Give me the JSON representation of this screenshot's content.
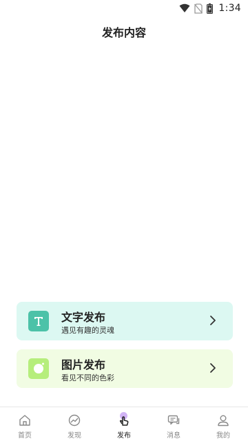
{
  "status_bar": {
    "time": "1:34"
  },
  "page": {
    "title": "发布内容"
  },
  "cards": [
    {
      "title": "文字发布",
      "subtitle": "遇见有趣的灵魂",
      "icon": "text-t-icon",
      "color": "#4cc2a8",
      "bg": "#dcf8f2"
    },
    {
      "title": "图片发布",
      "subtitle": "看见不同的色彩",
      "icon": "camera-lens-icon",
      "color": "#b6ee7c",
      "bg": "#f1fce3"
    }
  ],
  "tabbar": {
    "items": [
      {
        "label": "首页",
        "icon": "home-icon",
        "active": false
      },
      {
        "label": "发现",
        "icon": "discover-icon",
        "active": false
      },
      {
        "label": "发布",
        "icon": "tap-hand-icon",
        "active": true
      },
      {
        "label": "消息",
        "icon": "message-icon",
        "active": false
      },
      {
        "label": "我的",
        "icon": "profile-icon",
        "active": false
      }
    ]
  }
}
